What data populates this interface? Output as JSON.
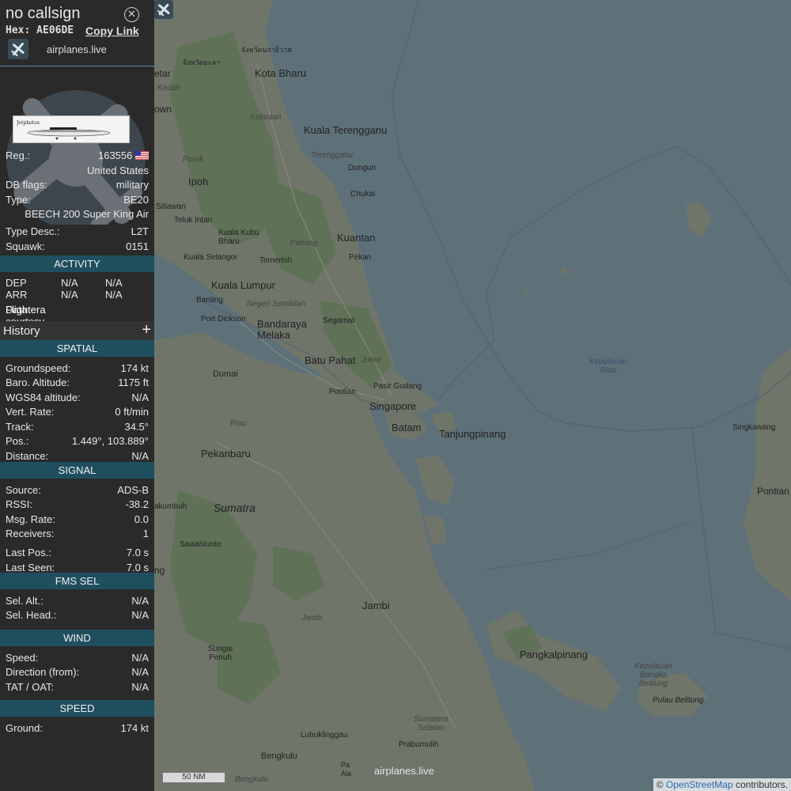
{
  "header": {
    "callsign": "no callsign",
    "hex_line": "Hex: AE06DE",
    "copy_link": "Copy Link",
    "site_name": "airplanes.live"
  },
  "aircraft": {
    "reg_label": "Reg.:",
    "reg": "163556",
    "country": "United States",
    "flags_label": "DB flags:",
    "flags": "military",
    "type_label": "Type:",
    "type": "BE20",
    "type_full": "BEECH 200 Super King Air",
    "type_desc_label": "Type Desc.:",
    "type_desc": "L2T",
    "squawk_label": "Squawk:",
    "squawk": "0151"
  },
  "activity": {
    "title": "ACTIVITY",
    "dep_label": "DEP",
    "arr_label": "ARR",
    "na": "N/A",
    "courtesy_prefix": "Data courtesy of",
    "courtesy_source": "Flightera"
  },
  "history": {
    "title": "History",
    "plus": "+"
  },
  "spatial": {
    "title": "SPATIAL",
    "rows": [
      {
        "label": "Groundspeed:",
        "value": "174 kt"
      },
      {
        "label": "Baro. Altitude:",
        "value": "1175 ft"
      },
      {
        "label": "WGS84 altitude:",
        "value": "N/A"
      },
      {
        "label": "Vert. Rate:",
        "value": "0 ft/min"
      },
      {
        "label": "Track:",
        "value": "34.5°"
      },
      {
        "label": "Pos.:",
        "value": "1.449°, 103.889°"
      },
      {
        "label": "Distance:",
        "value": "N/A"
      }
    ]
  },
  "signal": {
    "title": "SIGNAL",
    "rows": [
      {
        "label": "Source:",
        "value": "ADS-B"
      },
      {
        "label": "RSSI:",
        "value": "-38.2"
      },
      {
        "label": "Msg. Rate:",
        "value": "0.0"
      },
      {
        "label": "Receivers:",
        "value": "1"
      },
      {
        "label": "Last Pos.:",
        "value": "7.0 s"
      },
      {
        "label": "Last Seen:",
        "value": "7.0 s"
      }
    ]
  },
  "fms": {
    "title": "FMS SEL",
    "rows": [
      {
        "label": "Sel. Alt.:",
        "value": "N/A"
      },
      {
        "label": "Sel. Head.:",
        "value": "N/A"
      }
    ]
  },
  "wind": {
    "title": "WIND",
    "rows": [
      {
        "label": "Speed:",
        "value": "N/A"
      },
      {
        "label": "Direction (from):",
        "value": "N/A"
      },
      {
        "label": "TAT / OAT:",
        "value": "N/A"
      }
    ]
  },
  "speed": {
    "title": "SPEED",
    "rows": [
      {
        "label": "Ground:",
        "value": "174 kt"
      }
    ]
  },
  "map": {
    "labels": {
      "kota_bharu": "Kota Bharu",
      "kuala_terengganu": "Kuala Terengganu",
      "kelantan": "Kelantan",
      "terengganu": "Terengganu",
      "dungun": "Dungun",
      "chukai": "Chukai",
      "kuantan": "Kuantan",
      "pekan": "Pekan",
      "ipoh": "Ipoh",
      "perak": "Perak",
      "kedah": "Kedah",
      "etar": "etar",
      "own": "own",
      "sitiawan": "Sitiawan",
      "teluk_intan": "Teluk Intan",
      "kuala_kubu_bharu": "Kuala Kubu Bharu",
      "pahang": "Pahang",
      "kuala_selangor": "Kuala Selangor",
      "temerloh": "Temerloh",
      "kuala_lumpur": "Kuala Lumpur",
      "banting": "Banting",
      "negeri_sembilan": "Negeri Sembilan",
      "port_dickson": "Port Dickson",
      "bandaraya_melaka": "Bandaraya Melaka",
      "segamat": "Segamat",
      "batu_pahat": "Batu Pahat",
      "johor": "Johor",
      "pontian": "Pontian",
      "pasir_gudang": "Pasir Gudang",
      "singapore": "Singapore",
      "batam": "Batam",
      "tanjungpinang": "Tanjungpinang",
      "dumai": "Dumai",
      "riau": "Riau",
      "pekanbaru": "Pekanbaru",
      "sumatra": "Sumatra",
      "akumbuh": "akumbuh",
      "sawahlunto": "Sawahlunto",
      "ng": "ng",
      "jambi": "Jambi",
      "jambi_prov": "Jambi",
      "sungai_penuh": "Sungai\nPenuh",
      "pangkalpinang": "Pangkalpinang",
      "kep_bangka": "Kepulauan\nBangka\nBelitung",
      "pulau_belitung": "Pulau Belitung",
      "kep_riau": "Kepulauan\nRiau",
      "singkawang": "Singkawang",
      "pontian_e": "Pontian",
      "sumatera_selatan": "Sumatera\nSelatan",
      "lubuklinggau": "Lubuklinggau",
      "prabumulih": "Prabumulih",
      "bengkulu": "Bengkulu",
      "bengkulu_prov": "Bengkulu",
      "thai_1": "จังหวัดนราธิวาส",
      "thai_2": "จังหวัดยะลา",
      "pa": "Pa",
      "ala": "Ala"
    },
    "scale": "50 NM",
    "attribution_prefix": "©",
    "attribution_link": "OpenStreetMap",
    "attribution_suffix": "contributors.",
    "watermark": "airplanes.live"
  }
}
